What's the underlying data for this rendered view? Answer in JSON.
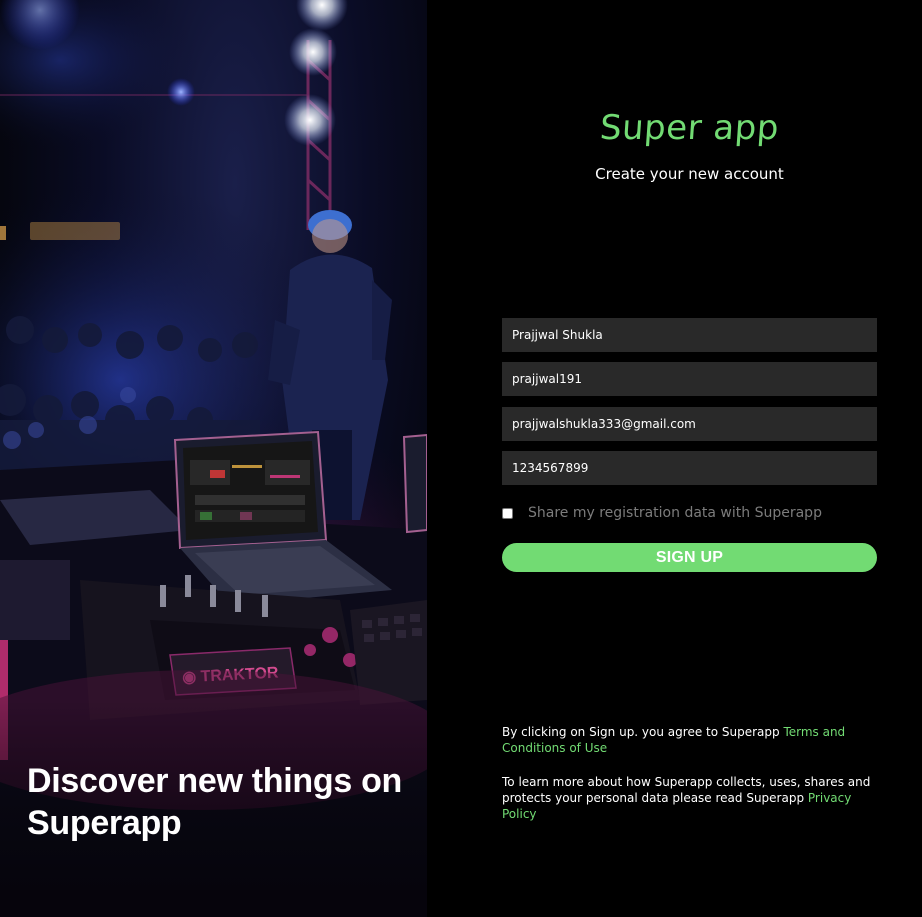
{
  "hero": {
    "title": "Discover new things on Superapp",
    "image_description": "DJ performing on stage with laptop and mixer"
  },
  "form": {
    "brand": "Super app",
    "subtitle": "Create your new account",
    "fields": {
      "name": "Prajjwal Shukla",
      "username": "prajjwal191",
      "email": "prajjwalshukla333@gmail.com",
      "mobile": "1234567899"
    },
    "consent_label": "Share my registration data with Superapp",
    "consent_checked": false,
    "signup_label": "SIGN UP"
  },
  "legal": {
    "terms_prefix": "By clicking on Sign up. you agree to Superapp ",
    "terms_link": "Terms and Conditions of Use",
    "privacy_prefix": "To learn more about how Superapp collects, uses, shares and protects your personal data please read Superapp ",
    "privacy_link": "Privacy Policy"
  },
  "colors": {
    "accent": "#72DB73",
    "background": "#000000",
    "field_bg": "#292929",
    "muted_text": "#7C7C7C"
  }
}
